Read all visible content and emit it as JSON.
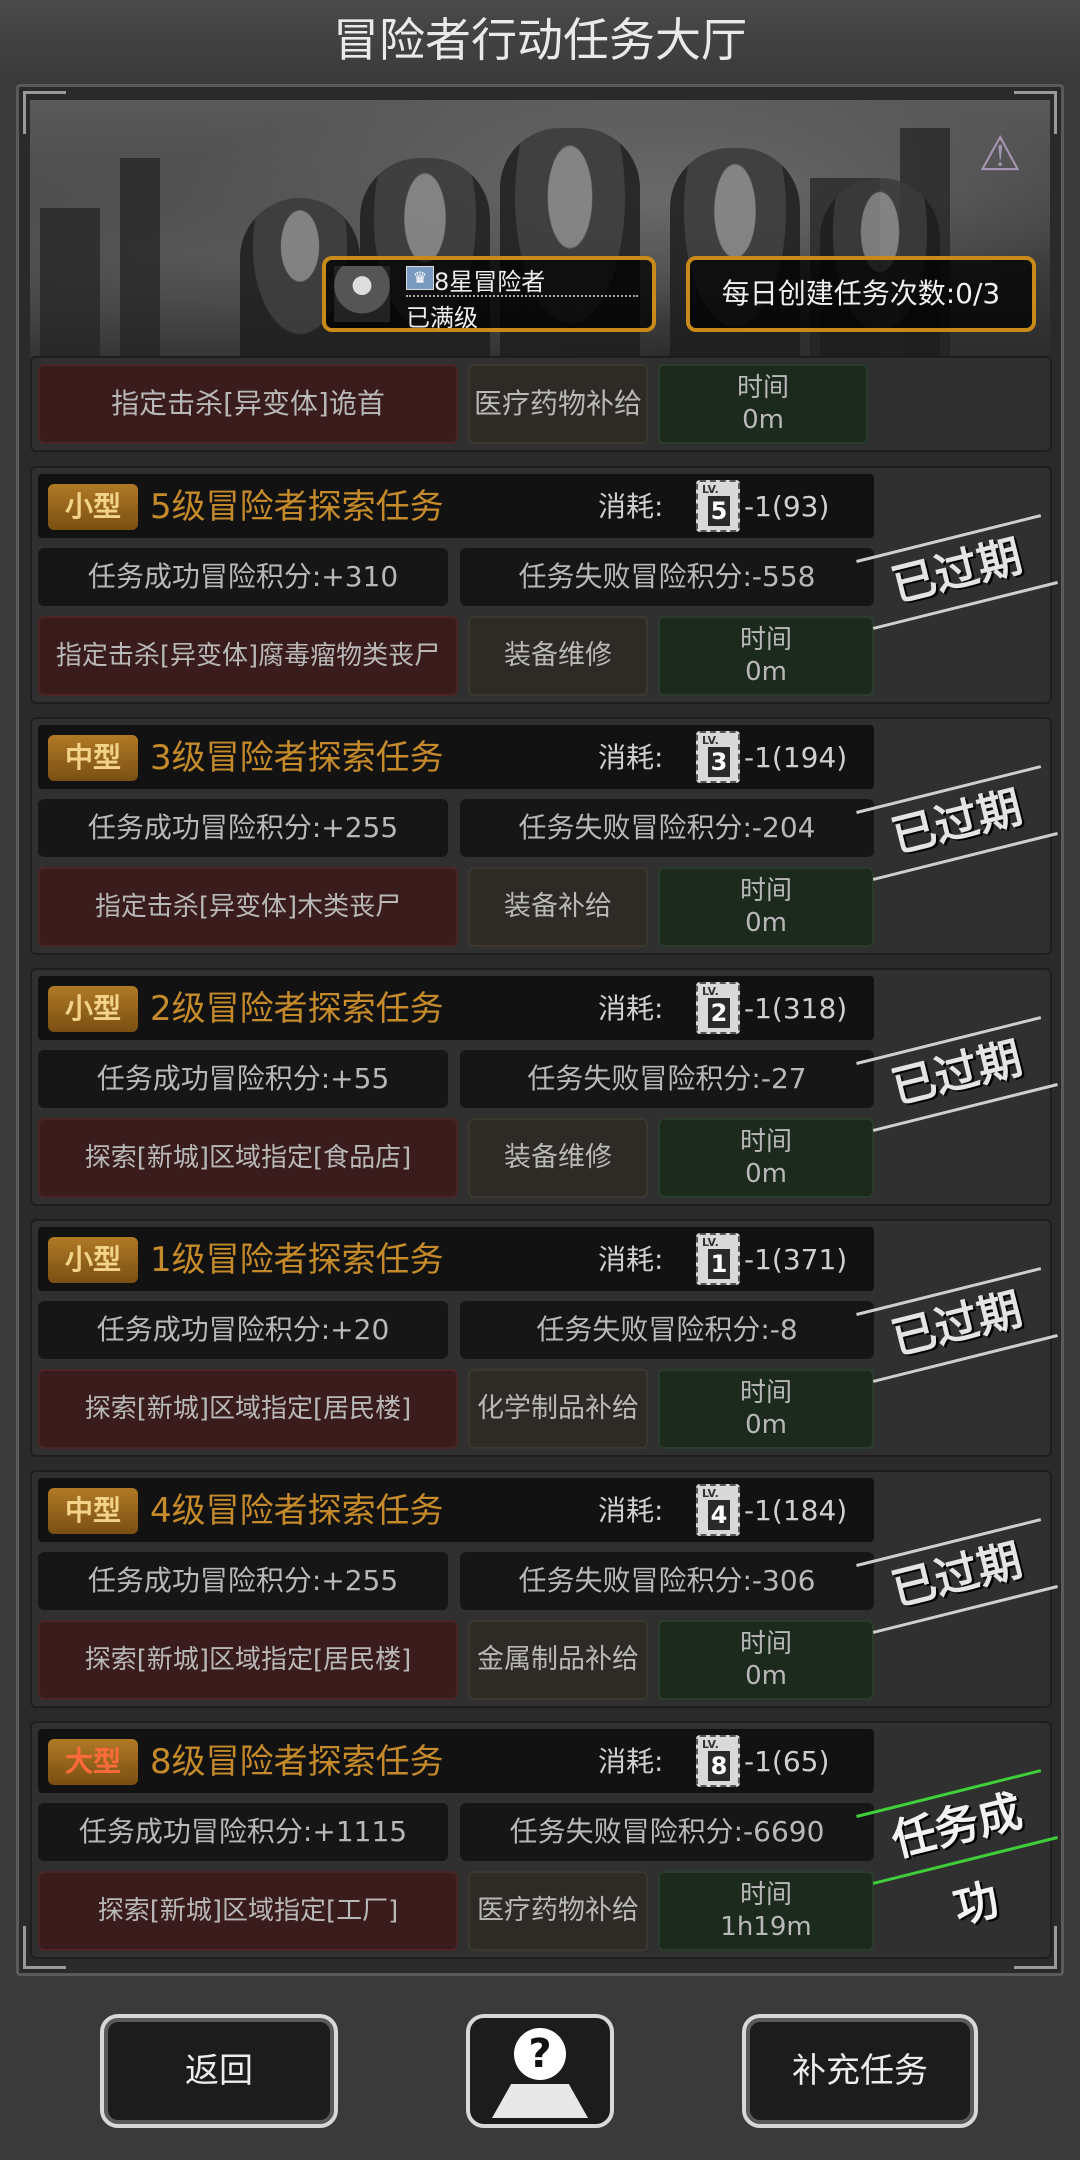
{
  "title": "冒险者行动任务大厅",
  "banner": {
    "rank_name": "8星冒险者",
    "rank_status": "已满级",
    "daily_label": "每日创建任务次数:0/3"
  },
  "partial_card": {
    "target": "指定击杀[异变体]诡首",
    "supply": "医疗药物补给",
    "time_label": "时间",
    "time_value": "0m"
  },
  "cost_label": "消耗:",
  "time_label": "时间",
  "tasks": [
    {
      "size": "小型",
      "title": "5级冒险者探索任务",
      "lv": "5",
      "cost": "-1(93)",
      "success": "任务成功冒险积分:+310",
      "fail": "任务失败冒险积分:-558",
      "target": "指定击杀[异变体]腐毒瘤物类丧尸",
      "supply": "装备维修",
      "time": "0m",
      "status": "已过期"
    },
    {
      "size": "中型",
      "title": "3级冒险者探索任务",
      "lv": "3",
      "cost": "-1(194)",
      "success": "任务成功冒险积分:+255",
      "fail": "任务失败冒险积分:-204",
      "target": "指定击杀[异变体]木类丧尸",
      "supply": "装备补给",
      "time": "0m",
      "status": "已过期"
    },
    {
      "size": "小型",
      "title": "2级冒险者探索任务",
      "lv": "2",
      "cost": "-1(318)",
      "success": "任务成功冒险积分:+55",
      "fail": "任务失败冒险积分:-27",
      "target": "探索[新城]区域指定[食品店]",
      "supply": "装备维修",
      "time": "0m",
      "status": "已过期"
    },
    {
      "size": "小型",
      "title": "1级冒险者探索任务",
      "lv": "1",
      "cost": "-1(371)",
      "success": "任务成功冒险积分:+20",
      "fail": "任务失败冒险积分:-8",
      "target": "探索[新城]区域指定[居民楼]",
      "supply": "化学制品补给",
      "time": "0m",
      "status": "已过期"
    },
    {
      "size": "中型",
      "title": "4级冒险者探索任务",
      "lv": "4",
      "cost": "-1(184)",
      "success": "任务成功冒险积分:+255",
      "fail": "任务失败冒险积分:-306",
      "target": "探索[新城]区域指定[居民楼]",
      "supply": "金属制品补给",
      "time": "0m",
      "status": "已过期"
    },
    {
      "size": "大型",
      "title": "8级冒险者探索任务",
      "lv": "8",
      "cost": "-1(65)",
      "success": "任务成功冒险积分:+1115",
      "fail": "任务失败冒险积分:-6690",
      "target": "探索[新城]区域指定[工厂]",
      "supply": "医疗药物补给",
      "time": "1h19m",
      "status": "任务成功"
    }
  ],
  "lv_text": "LV.",
  "buttons": {
    "back": "返回",
    "help": "?",
    "refill": "补充任务"
  }
}
